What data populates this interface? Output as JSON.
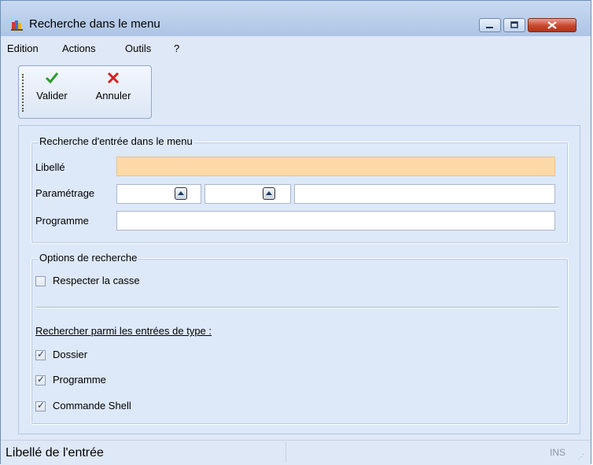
{
  "window": {
    "title": "Recherche dans le menu"
  },
  "menubar": {
    "items": [
      "Edition",
      "Actions",
      "Outils",
      "?"
    ]
  },
  "toolbar": {
    "validate_label": "Valider",
    "cancel_label": "Annuler"
  },
  "search_group": {
    "legend": "Recherche d'entrée dans le menu",
    "libelle_label": "Libellé",
    "libelle_value": "",
    "parametrage_label": "Paramétrage",
    "param1_value": "",
    "param2_value": "",
    "param3_value": "",
    "programme_label": "Programme",
    "programme_value": ""
  },
  "options_group": {
    "legend": "Options de recherche",
    "case_label": "Respecter la casse",
    "case_checked": false,
    "types_heading": "Rechercher parmi les entrées de type :",
    "types": [
      {
        "label": "Dossier",
        "checked": true
      },
      {
        "label": "Programme",
        "checked": true
      },
      {
        "label": "Commande Shell",
        "checked": true
      }
    ]
  },
  "status": {
    "text": "Libellé de l'entrée",
    "mode": "INS"
  },
  "colors": {
    "focus_field": "#fdd9a7",
    "valider": "#2e9c2e",
    "annuler": "#d42020"
  }
}
